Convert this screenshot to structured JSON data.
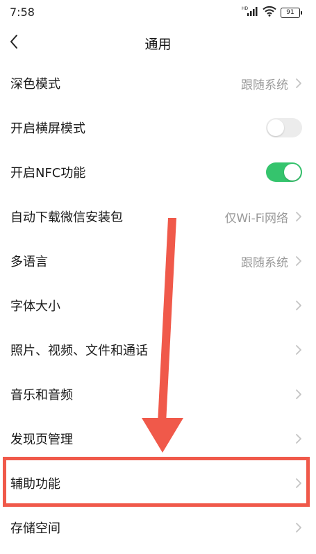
{
  "status_bar": {
    "time": "7:58",
    "battery_level": "91",
    "icons": [
      "hd-signal-icon",
      "wifi-icon",
      "battery-icon"
    ]
  },
  "header": {
    "title": "通用",
    "back_icon": "chevron-left-icon"
  },
  "settings": [
    {
      "label": "深色模式",
      "value": "跟随系统",
      "control": "chevron"
    },
    {
      "label": "开启横屏模式",
      "control": "toggle",
      "toggle_on": false
    },
    {
      "label": "开启NFC功能",
      "control": "toggle",
      "toggle_on": true
    },
    {
      "label": "自动下载微信安装包",
      "value": "仅Wi-Fi网络",
      "control": "chevron"
    },
    {
      "label": "多语言",
      "value": "跟随系统",
      "control": "chevron"
    },
    {
      "label": "字体大小",
      "control": "chevron"
    },
    {
      "label": "照片、视频、文件和通话",
      "control": "chevron"
    },
    {
      "label": "音乐和音频",
      "control": "chevron"
    },
    {
      "label": "发现页管理",
      "control": "chevron"
    },
    {
      "label": "辅助功能",
      "control": "chevron",
      "highlighted": true
    },
    {
      "label": "存储空间",
      "control": "chevron"
    }
  ],
  "annotation": {
    "arrow_color": "#f0594a",
    "highlight_color": "#f0594a",
    "highlighted_item": "辅助功能"
  },
  "colors": {
    "toggle_on": "#35c46d",
    "toggle_off": "#ececec",
    "secondary_text": "#9a9a9a"
  }
}
